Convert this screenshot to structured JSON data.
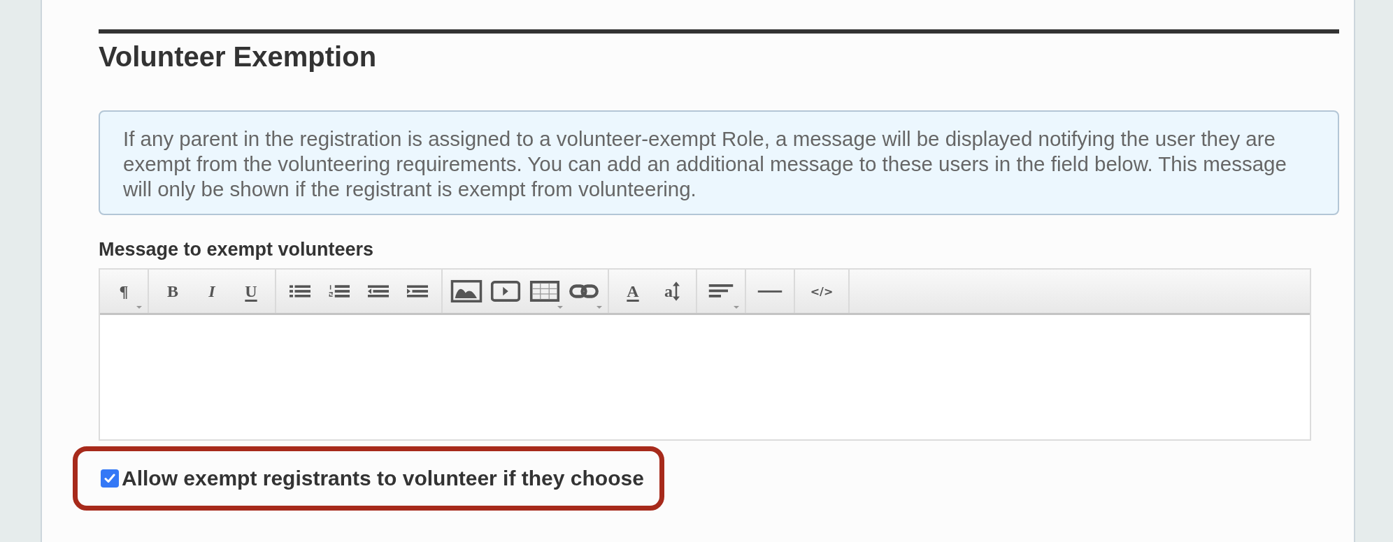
{
  "section": {
    "title": "Volunteer Exemption"
  },
  "info": {
    "text": "If any parent in the registration is assigned to a volunteer-exempt Role, a message will be displayed notifying the user they are exempt from the volunteering requirements. You can add an additional message to these users in the field below. This message will only be shown if the registrant is exempt from volunteering."
  },
  "editor": {
    "label": "Message to exempt volunteers",
    "toolbar": [
      [
        {
          "kind": "glyph",
          "label": "¶",
          "dropdown": true
        }
      ],
      [
        {
          "kind": "glyph",
          "label": "B",
          "dropdown": false
        },
        {
          "kind": "italic",
          "label": "I",
          "dropdown": false
        },
        {
          "kind": "underline",
          "label": "U",
          "dropdown": false
        }
      ],
      [
        {
          "kind": "bullets",
          "dropdown": false
        },
        {
          "kind": "numbers",
          "dropdown": false
        },
        {
          "kind": "outdent",
          "dropdown": false
        },
        {
          "kind": "indent",
          "dropdown": false
        }
      ],
      [
        {
          "kind": "image",
          "dropdown": false
        },
        {
          "kind": "video",
          "dropdown": false
        },
        {
          "kind": "table",
          "dropdown": true
        },
        {
          "kind": "link",
          "dropdown": true
        }
      ],
      [
        {
          "kind": "color",
          "label": "A",
          "dropdown": false
        },
        {
          "kind": "size",
          "label": "a",
          "dropdown": false
        }
      ],
      [
        {
          "kind": "align",
          "dropdown": true
        }
      ],
      [
        {
          "kind": "rule",
          "dropdown": false
        }
      ],
      [
        {
          "kind": "code",
          "label": "</>",
          "dropdown": false
        }
      ]
    ]
  },
  "option": {
    "label": "Allow exempt registrants to volunteer if they choose",
    "checked": true,
    "highlighted": true
  }
}
